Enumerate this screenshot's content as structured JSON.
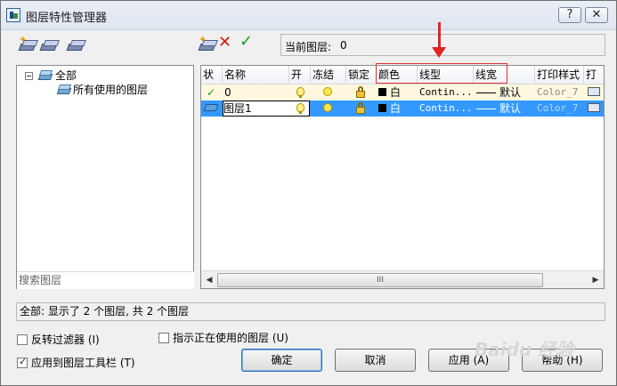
{
  "window": {
    "title": "图层特性管理器",
    "help_glyph": "?",
    "close_glyph": "✕"
  },
  "toolbar": {
    "current_layer_label": "当前图层:",
    "current_layer_value": "0",
    "delete_glyph": "✕",
    "set_current_glyph": "✓"
  },
  "tree": {
    "root_label": "全部",
    "child_label": "所有使用的图层",
    "search_placeholder": "搜索图层"
  },
  "table": {
    "columns": [
      "状",
      "名称",
      "开",
      "冻结",
      "锁定",
      "颜色",
      "线型",
      "线宽",
      "打印样式",
      "打"
    ],
    "rows": [
      {
        "status": "✓",
        "name": "0",
        "color": "白",
        "linetype": "Contin...",
        "lineweight": "默认",
        "plot_style": "Color_7"
      },
      {
        "status": "",
        "name": "图层1",
        "color": "白",
        "linetype": "Contin...",
        "lineweight": "默认",
        "plot_style": "Color_7"
      }
    ]
  },
  "scrollbar": {
    "left": "◀",
    "right": "▶",
    "grip": "III"
  },
  "status_text": "全部: 显示了 2 个图层, 共 2 个图层",
  "options": {
    "invert_filter": "反转过滤器 (I)",
    "indicate_in_use": "指示正在使用的图层 (U)",
    "apply_toolbar": "应用到图层工具栏 (T)"
  },
  "buttons": {
    "ok": "确定",
    "cancel": "取消",
    "apply": "应用 (A)",
    "help": "帮助 (H)"
  },
  "watermark": "Baidu 经验",
  "colors": {
    "selection": "#3399ff",
    "annotation": "#e03030",
    "current_row": "#fff8df"
  }
}
